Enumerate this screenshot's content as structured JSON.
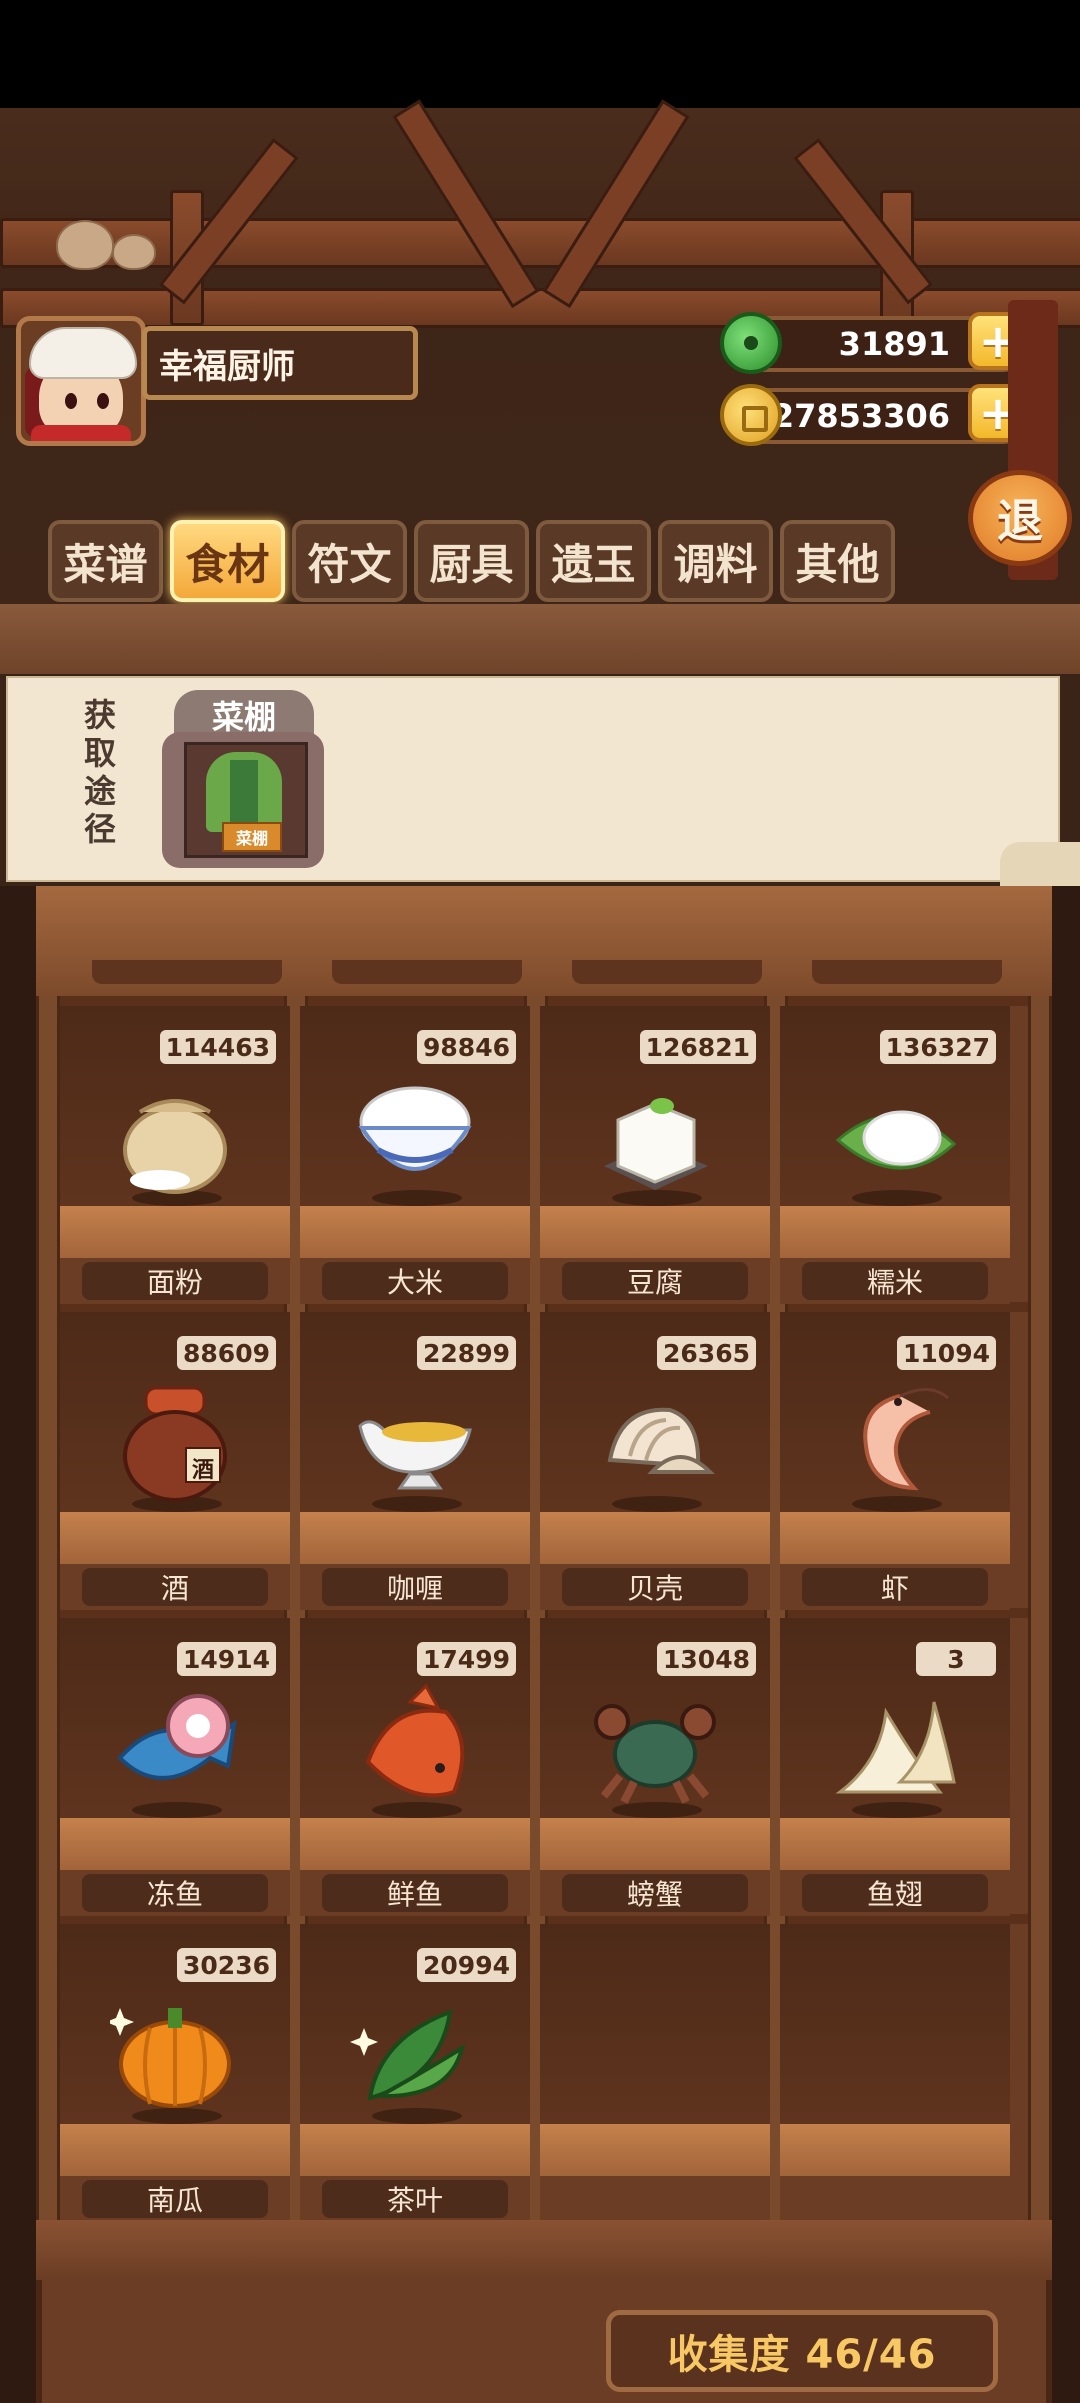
{
  "player": {
    "name": "幸福厨师"
  },
  "currency": {
    "jade": "31891",
    "coins": "27853306",
    "plus": "+"
  },
  "exit_label": "退",
  "tabs": [
    {
      "label": "菜谱",
      "active": false
    },
    {
      "label": "食材",
      "active": true
    },
    {
      "label": "符文",
      "active": false
    },
    {
      "label": "厨具",
      "active": false
    },
    {
      "label": "遗玉",
      "active": false
    },
    {
      "label": "调料",
      "active": false
    },
    {
      "label": "其他",
      "active": false
    }
  ],
  "source": {
    "label": "获取途径",
    "item_name": "菜棚",
    "icon_sign": "菜棚"
  },
  "items": [
    {
      "name": "面粉",
      "count": "114463",
      "icon": "flour-sack-icon"
    },
    {
      "name": "大米",
      "count": "98846",
      "icon": "rice-bowl-icon"
    },
    {
      "name": "豆腐",
      "count": "126821",
      "icon": "tofu-icon"
    },
    {
      "name": "糯米",
      "count": "136327",
      "icon": "sticky-rice-leaf-icon"
    },
    {
      "name": "酒",
      "count": "88609",
      "icon": "wine-jar-icon",
      "jar_label": "酒"
    },
    {
      "name": "咖喱",
      "count": "22899",
      "icon": "curry-gravy-boat-icon"
    },
    {
      "name": "贝壳",
      "count": "26365",
      "icon": "clam-shell-icon"
    },
    {
      "name": "虾",
      "count": "11094",
      "icon": "shrimp-icon"
    },
    {
      "name": "冻鱼",
      "count": "14914",
      "icon": "frozen-fish-icon"
    },
    {
      "name": "鲜鱼",
      "count": "17499",
      "icon": "fresh-fish-icon"
    },
    {
      "name": "螃蟹",
      "count": "13048",
      "icon": "crab-icon"
    },
    {
      "name": "鱼翅",
      "count": "3",
      "icon": "shark-fin-icon"
    },
    {
      "name": "南瓜",
      "count": "30236",
      "icon": "pumpkin-icon"
    },
    {
      "name": "茶叶",
      "count": "20994",
      "icon": "tea-leaves-icon"
    }
  ],
  "collection": "收集度 46/46"
}
